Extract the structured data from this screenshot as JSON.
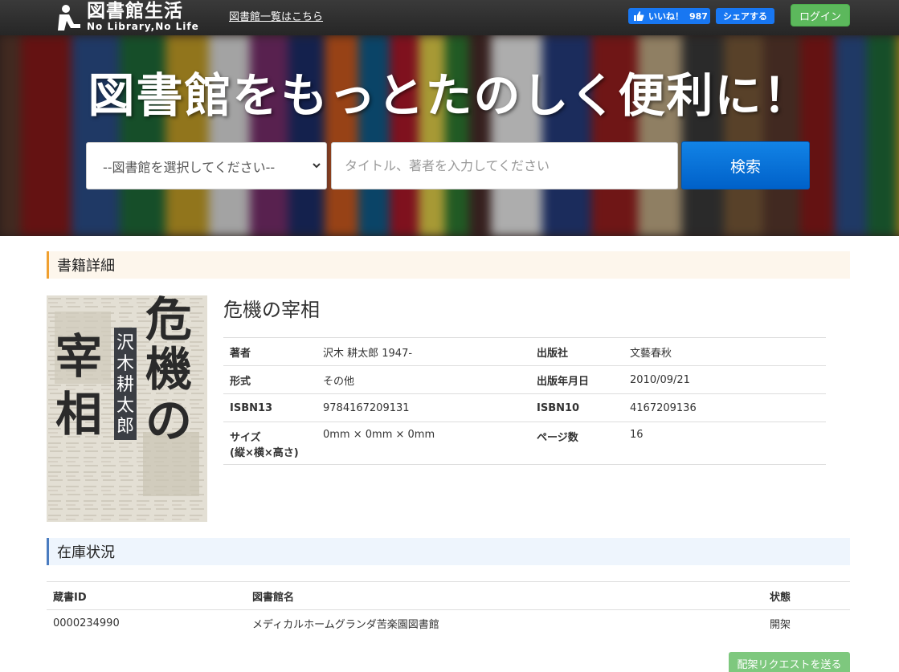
{
  "header": {
    "logo_title": "図書館生活",
    "logo_subtitle": "No Library,No Life",
    "library_list_link": "図書館一覧はこちら",
    "like_label": "いいね！",
    "like_count": "987",
    "share_label": "シェアする",
    "login_label": "ログイン"
  },
  "hero": {
    "title": "図書館をもっとたのしく便利に！",
    "select_value": "--図書館を選択してください--",
    "search_placeholder": "タイトル、著者を入力してください",
    "search_button": "検索"
  },
  "book": {
    "section_title": "書籍詳細",
    "title": "危機の宰相",
    "cover_title": "危機の宰相",
    "cover_author": "沢木耕太郎",
    "details": [
      {
        "label": "著者",
        "value": "沢木 耕太郎 1947-",
        "label2": "出版社",
        "value2": "文藝春秋"
      },
      {
        "label": "形式",
        "value": "その他",
        "label2": "出版年月日",
        "value2": "2010/09/21"
      },
      {
        "label": "ISBN13",
        "value": "9784167209131",
        "label2": "ISBN10",
        "value2": "4167209136"
      },
      {
        "label": "サイズ\n(縦×横×高さ)",
        "value": "0mm × 0mm × 0mm",
        "label2": "ページ数",
        "value2": "16"
      }
    ]
  },
  "stock": {
    "section_title": "在庫状況",
    "columns": [
      "蔵書ID",
      "図書館名",
      "状態"
    ],
    "rows": [
      {
        "id": "0000234990",
        "library": "メディカルホームグランダ苦楽園図書館",
        "status": "開架"
      }
    ],
    "request_button": "配架リクエストを送る"
  },
  "colors": {
    "topbar": "#2e2e2e",
    "facebook": "#1877f2",
    "login": "#5cb85c",
    "search_button": "#0a6fd8",
    "book_section_accent": "#f0a030",
    "stock_section_accent": "#4a7cc0"
  }
}
